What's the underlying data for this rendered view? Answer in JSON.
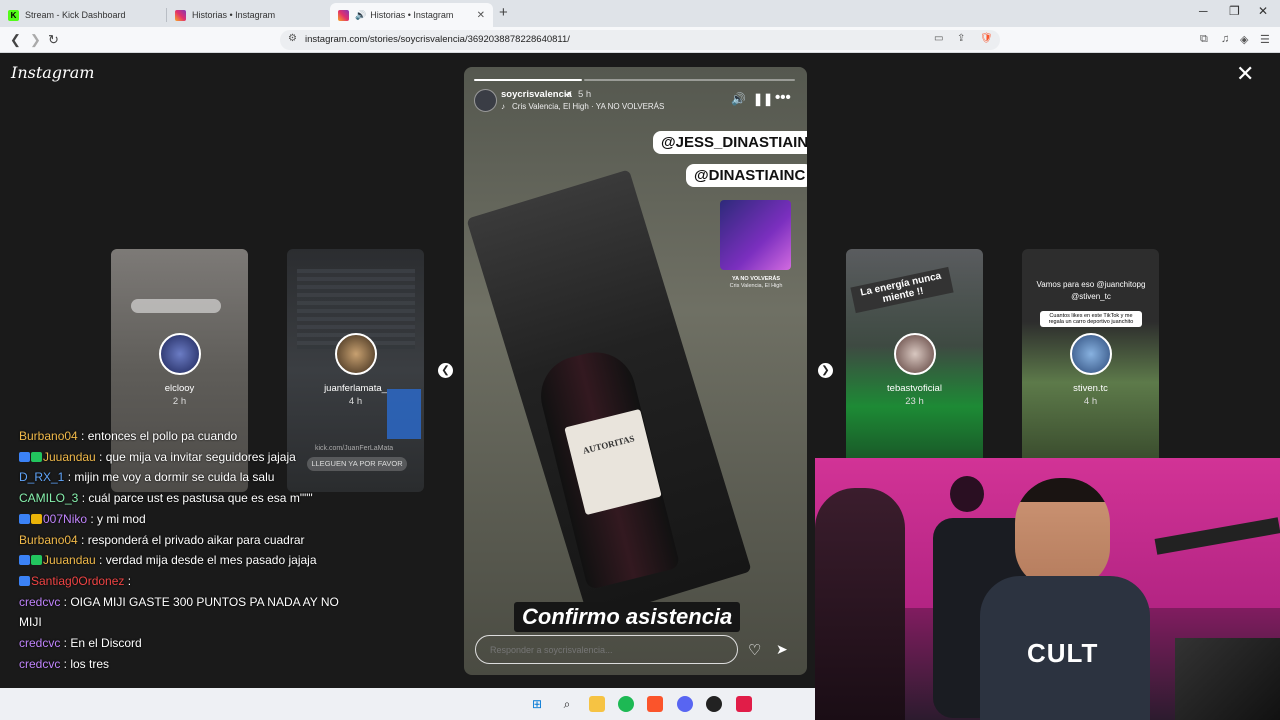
{
  "browser": {
    "tabs": [
      {
        "label": "Stream - Kick Dashboard",
        "favicon": "K"
      },
      {
        "label": "Historias • Instagram"
      },
      {
        "label": "Historias • Instagram"
      }
    ],
    "url": "instagram.com/stories/soycrisvalencia/3692038878228640811/"
  },
  "instagram": {
    "logo": "Instagram",
    "side_stories": [
      {
        "username": "elclooy",
        "time": "2 h"
      },
      {
        "username": "juanferlamata_",
        "time": "4 h",
        "overlay_text": "kick.com/JuanFerLaMata",
        "overlay_btn": "LLEGUEN YA POR FAVOR"
      },
      {
        "username": "tebastvoficial",
        "time": "23 h",
        "overlay_text": "La energía nunca miente !!"
      },
      {
        "username": "stiven.tc",
        "time": "4 h",
        "overlay_text": "Vamos para eso @juanchitopg @stiven_tc",
        "overlay_sub": "Cuantos likes en este TikTok y me regala un carro deportivo juanchito"
      }
    ],
    "story": {
      "username": "soycrisvalencia",
      "time": "5 h",
      "song": "Cris Valencia, El High · YA NO VOLVERÁS",
      "mentions": [
        "@JESS_DINASTIAINC",
        "@DINASTIAINC"
      ],
      "music_card_title": "YA NO VOLVERÁS",
      "music_card_artist": "Cris Valencia, El High",
      "bottle_label": "AUTORITAS",
      "caption": "Confirmo asistencia",
      "reply_placeholder": "Responder a soycrisvalencia..."
    }
  },
  "chat": [
    {
      "user": "Burbano04",
      "color": "#f0b94a",
      "badges": [],
      "text": " : entonces el pollo pa cuando"
    },
    {
      "user": "Juuandau",
      "color": "#f0b94a",
      "badges": [
        "#3b82f6",
        "#22c55e"
      ],
      "text": " : que mija va invitar seguidores jajaja"
    },
    {
      "user": "D_RX_1",
      "color": "#60a5fa",
      "badges": [],
      "text": " : mijin me voy a dormir se cuida la salu"
    },
    {
      "user": "CAMILO_3",
      "color": "#86efac",
      "badges": [],
      "text": " : cuál parce ust es pastusa que es esa m\"\"\""
    },
    {
      "user": "007Niko",
      "color": "#c084fc",
      "badges": [
        "#3b82f6",
        "#eab308"
      ],
      "text": " : y mi mod"
    },
    {
      "user": "Burbano04",
      "color": "#f0b94a",
      "badges": [],
      "text": " : responderá el privado aikar para cuadrar"
    },
    {
      "user": "Juuandau",
      "color": "#f0b94a",
      "badges": [
        "#3b82f6",
        "#22c55e"
      ],
      "text": " : verdad mija desde el mes pasado jajaja"
    },
    {
      "user": "Santiag0Ordonez",
      "color": "#ef4444",
      "badges": [
        "#3b82f6"
      ],
      "text": " : "
    },
    {
      "user": "credcvc",
      "color": "#c084fc",
      "badges": [],
      "text": " : OIGA MIJI GASTE 300 PUNTOS PA NADA AY NO MIJI"
    },
    {
      "user": "credcvc",
      "color": "#c084fc",
      "badges": [],
      "text": " : En el Discord"
    },
    {
      "user": "credcvc",
      "color": "#c084fc",
      "badges": [],
      "text": " : los tres"
    }
  ],
  "colors": {
    "page_bg": "#1a1a1a",
    "tabbar_bg": "#dfe3e8",
    "brave_orange": "#fb542b"
  },
  "webcam": {
    "shirt_text": "CULT"
  }
}
